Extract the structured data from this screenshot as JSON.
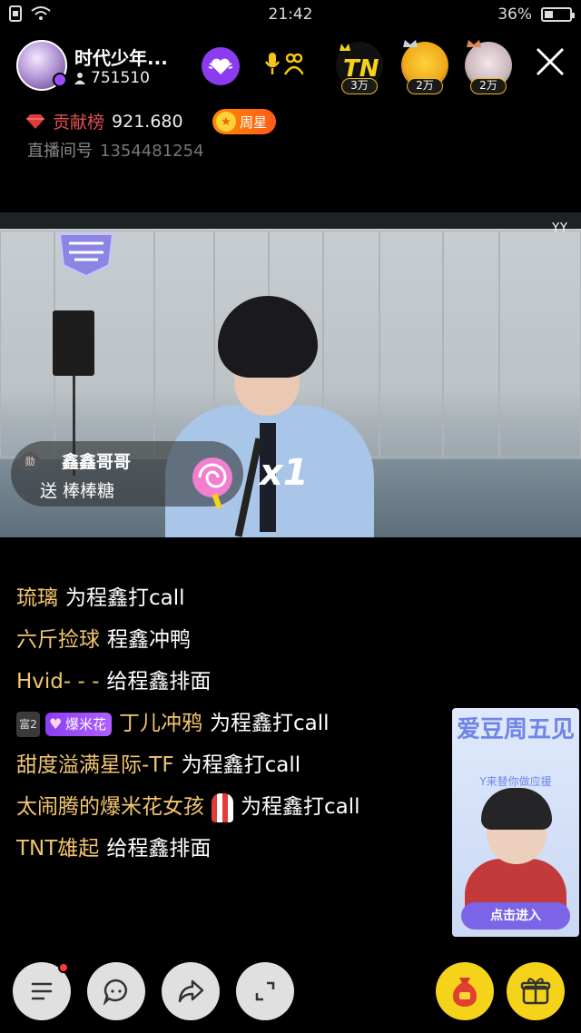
{
  "status_bar": {
    "time": "21:42",
    "battery_text": "36%",
    "battery_level": 0.36
  },
  "host": {
    "name": "时代少年...",
    "fans_count": "751510"
  },
  "ranking": [
    {
      "label": "3万",
      "name": "rank-avatar-1"
    },
    {
      "label": "2万",
      "name": "rank-avatar-2"
    },
    {
      "label": "2万",
      "name": "rank-avatar-3"
    }
  ],
  "contribution": {
    "label": "贡献榜",
    "value": "921.680"
  },
  "star_badge": {
    "label": "周星"
  },
  "room": {
    "label": "直播间号",
    "number": "1354481254"
  },
  "video": {
    "watermark": "YY"
  },
  "gift": {
    "sender": "鑫鑫哥哥",
    "desc": "送 棒棒糖",
    "count": "x1",
    "badge": "勋"
  },
  "chat": [
    {
      "user": "琉璃",
      "msg": "为程鑫打call"
    },
    {
      "user": "六斤捡球",
      "msg": "程鑫冲鸭"
    },
    {
      "user": "Hvid- - -",
      "msg": "给程鑫排面"
    },
    {
      "level": "富2",
      "fan_badge": "爆米花",
      "user": "丁儿冲鸦",
      "msg": "为程鑫打call"
    },
    {
      "user": "甜度溢满星际-TF",
      "msg": "为程鑫打call"
    },
    {
      "user": "太闹腾的爆米花女孩",
      "msg": "为程鑫打call"
    },
    {
      "user": "TNT雄起",
      "msg": "给程鑫排面"
    }
  ],
  "promo": {
    "title": "爱豆周五见",
    "subtitle": "Y来替你做应援",
    "button": "点击进入"
  },
  "colors": {
    "username": "#f2c66d",
    "accent_purple": "#8b3cf0",
    "action_yellow": "#f5d31b",
    "contribution_red": "#e05050"
  }
}
